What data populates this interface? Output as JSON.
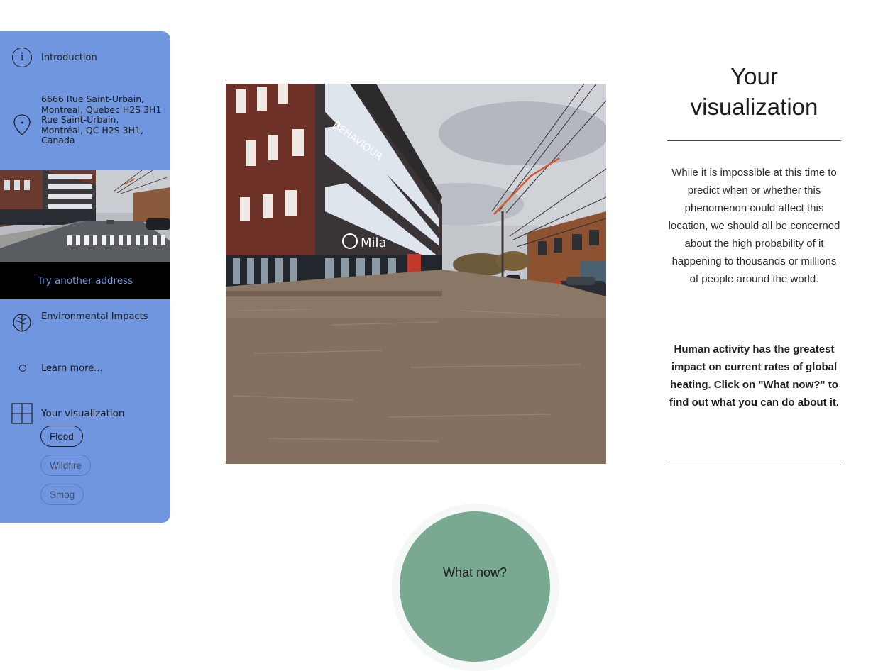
{
  "sidebar": {
    "intro_label": "Introduction",
    "address_label": "6666 Rue Saint-Urbain, Montreal, Quebec H2S 3H1 Rue Saint-Urbain, Montréal, QC H2S 3H1, Canada",
    "thumbnail": "street-view-thumbnail",
    "try_another_label": "Try another address",
    "environmental_label": "Environmental Impacts",
    "learn_more_label": "Learn more...",
    "visualization_label": "Your visualization",
    "options": [
      "Flood",
      "Wildfire",
      "Smog"
    ],
    "selected_option": "Flood"
  },
  "main": {
    "image": "flooded-street-visualization"
  },
  "right_panel": {
    "title": "Your visualization",
    "paragraph": "While it is impossible at this time to predict when or whether this phenomenon could affect this location, we should all be concerned about the high probability of it happening to thousands or millions of people around the world.",
    "bold_paragraph": "Human activity has the greatest impact on current rates of global heating. Click on \"What now?\" to find out what you can do about it."
  },
  "what_now_label": "What now?",
  "colors": {
    "sidebar": "#6f96df",
    "try_button_bg": "#000000",
    "try_button_text": "#6f96df",
    "what_now": "#79a991"
  }
}
